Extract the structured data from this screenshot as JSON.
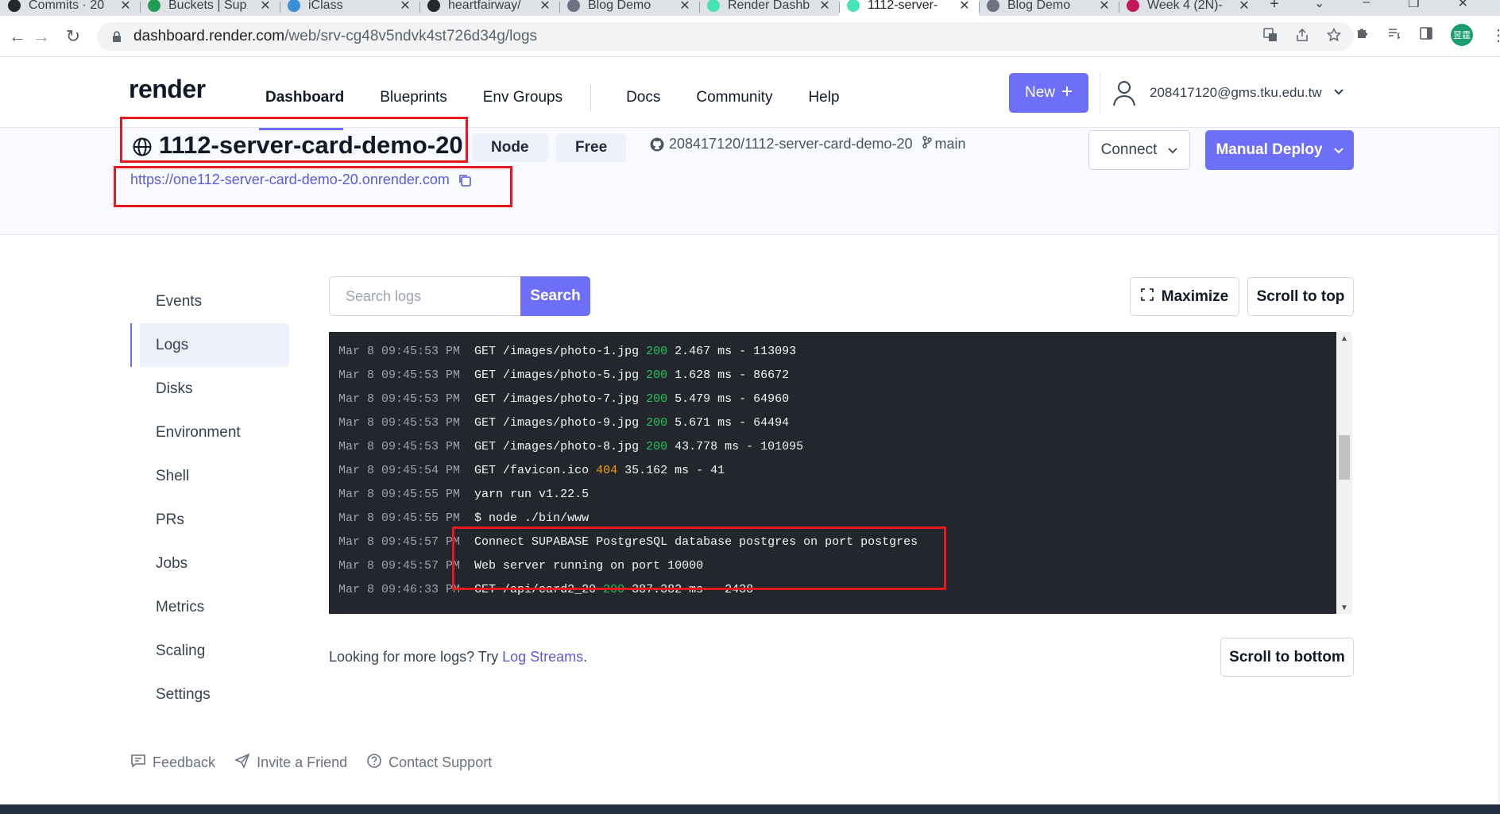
{
  "browser": {
    "tabs": [
      {
        "title": "Commits · 20",
        "color": "#24292f"
      },
      {
        "title": "Buckets | Sup",
        "color": "#1f9d55"
      },
      {
        "title": "iClass",
        "color": "#3a8fd8"
      },
      {
        "title": "heartfairway/",
        "color": "#24292f"
      },
      {
        "title": "Blog Demo",
        "color": "#6b7280"
      },
      {
        "title": "Render Dashb",
        "color": "#46e3b7"
      },
      {
        "title": "1112-server-",
        "color": "#46e3b7"
      },
      {
        "title": "Blog Demo",
        "color": "#6b7280"
      },
      {
        "title": "Week 4 (2N)-",
        "color": "#c2185b"
      }
    ],
    "new_tab": "+",
    "url_host": "dashboard.render.com",
    "url_path": "/web/srv-cg48v5ndvk4st726d34g/logs",
    "profile_initials": "昱霆"
  },
  "header": {
    "logo": "render",
    "nav": [
      "Dashboard",
      "Blueprints",
      "Env Groups"
    ],
    "nav_secondary": [
      "Docs",
      "Community",
      "Help"
    ],
    "new_label": "New",
    "user_email": "208417120@gms.tku.edu.tw"
  },
  "service": {
    "name": "1112-server-card-demo-20",
    "runtime": "Node",
    "plan": "Free",
    "repo": "208417120/1112-server-card-demo-20",
    "branch": "main",
    "url": "https://one112-server-card-demo-20.onrender.com",
    "connect_label": "Connect",
    "deploy_label": "Manual Deploy"
  },
  "sidebar": {
    "items": [
      "Events",
      "Logs",
      "Disks",
      "Environment",
      "Shell",
      "PRs",
      "Jobs",
      "Metrics",
      "Scaling",
      "Settings"
    ],
    "active": "Logs"
  },
  "logs": {
    "search_placeholder": "Search logs",
    "search_label": "Search",
    "maximize_label": "Maximize",
    "scroll_top_label": "Scroll to top",
    "scroll_bottom_label": "Scroll to bottom",
    "lines": [
      {
        "ts": "Mar 8 09:45:53 PM",
        "pre": "GET /images/photo-1.jpg ",
        "status": "200",
        "post": " 2.467 ms - 113093",
        "level": "ok"
      },
      {
        "ts": "Mar 8 09:45:53 PM",
        "pre": "GET /images/photo-5.jpg ",
        "status": "200",
        "post": " 1.628 ms - 86672",
        "level": "ok"
      },
      {
        "ts": "Mar 8 09:45:53 PM",
        "pre": "GET /images/photo-7.jpg ",
        "status": "200",
        "post": " 5.479 ms - 64960",
        "level": "ok"
      },
      {
        "ts": "Mar 8 09:45:53 PM",
        "pre": "GET /images/photo-9.jpg ",
        "status": "200",
        "post": " 5.671 ms - 64494",
        "level": "ok"
      },
      {
        "ts": "Mar 8 09:45:53 PM",
        "pre": "GET /images/photo-8.jpg ",
        "status": "200",
        "post": " 43.778 ms - 101095",
        "level": "ok"
      },
      {
        "ts": "Mar 8 09:45:54 PM",
        "pre": "GET /favicon.ico ",
        "status": "404",
        "post": " 35.162 ms - 41",
        "level": "warn"
      },
      {
        "ts": "Mar 8 09:45:55 PM",
        "pre": "yarn run v1.22.5",
        "status": "",
        "post": "",
        "level": ""
      },
      {
        "ts": "Mar 8 09:45:55 PM",
        "pre": "$ node ./bin/www",
        "status": "",
        "post": "",
        "level": ""
      },
      {
        "ts": "Mar 8 09:45:57 PM",
        "pre": "Connect SUPABASE PostgreSQL database postgres on port postgres",
        "status": "",
        "post": "",
        "level": ""
      },
      {
        "ts": "Mar 8 09:45:57 PM",
        "pre": "Web server running on port 10000",
        "status": "",
        "post": "",
        "level": ""
      },
      {
        "ts": "Mar 8 09:46:33 PM",
        "pre": "GET /api/card2_20 ",
        "status": "200",
        "post": " 387.382 ms - 2438",
        "level": "ok"
      }
    ],
    "more_text": "Looking for more logs? Try ",
    "more_link": "Log Streams",
    "more_end": "."
  },
  "footer": {
    "feedback": "Feedback",
    "invite": "Invite a Friend",
    "support": "Contact Support"
  },
  "colors": {
    "accent": "#6d6ff8",
    "highlight": "#e5191e",
    "log_bg": "#24262e"
  }
}
